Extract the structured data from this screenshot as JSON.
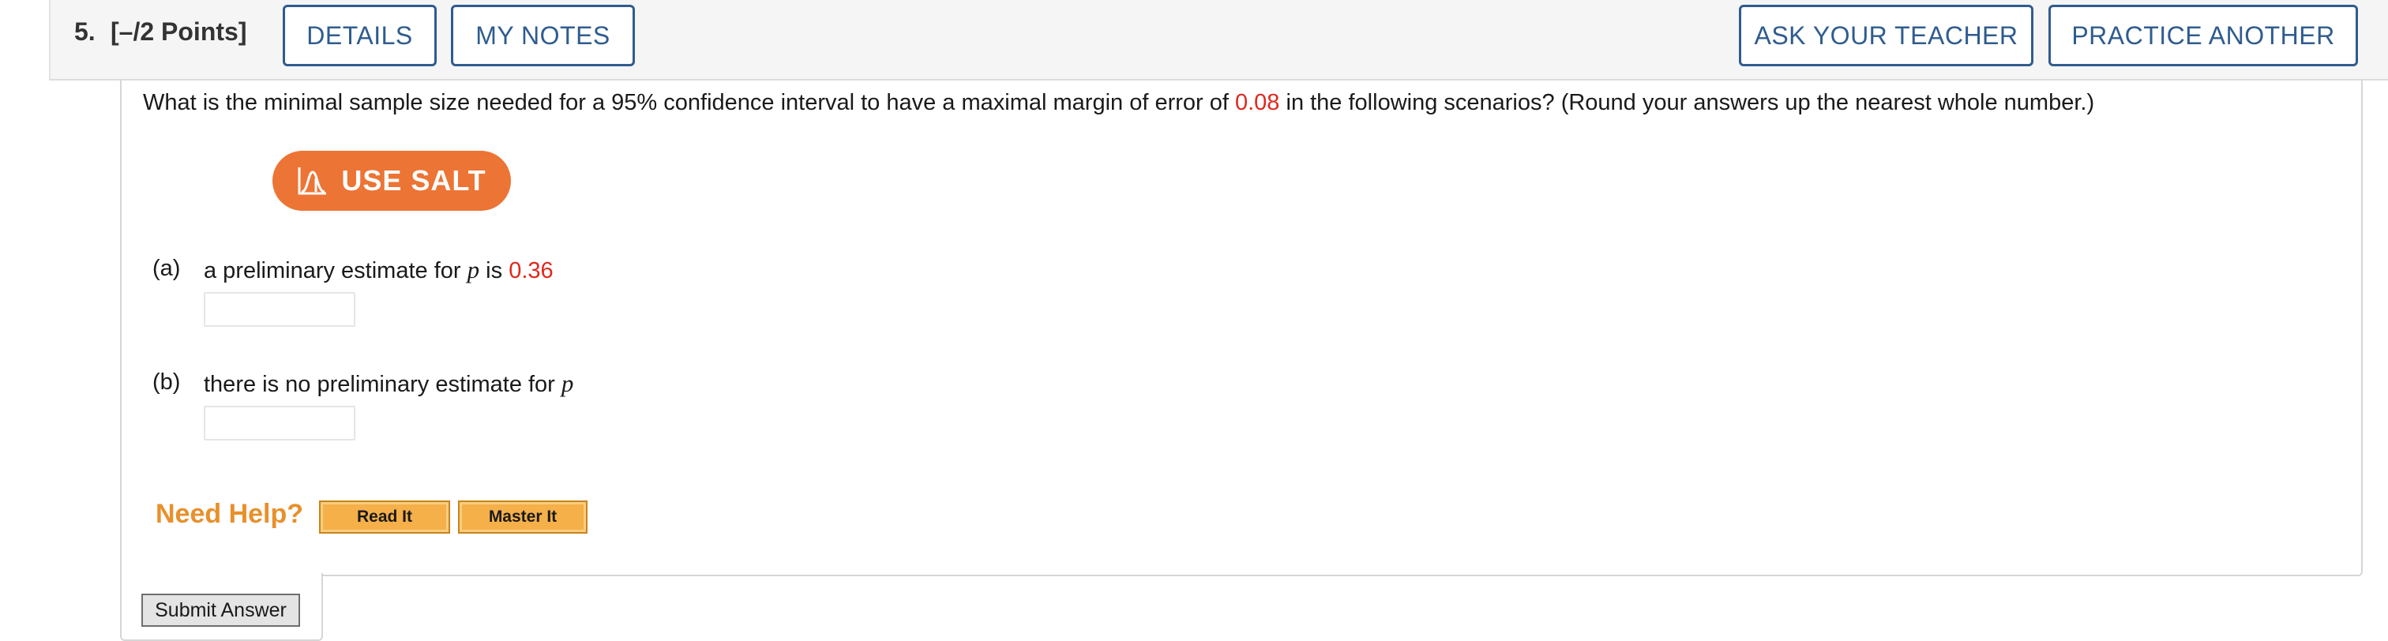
{
  "header": {
    "question_number": "5.",
    "points": "[–/2 Points]",
    "details_label": "DETAILS",
    "my_notes_label": "MY NOTES",
    "ask_teacher_label": "ASK YOUR TEACHER",
    "practice_another_label": "PRACTICE ANOTHER"
  },
  "question": {
    "text_before": "What is the minimal sample size needed for a 95% confidence interval to have a maximal margin of error of ",
    "margin_value": "0.08",
    "text_after": " in the following scenarios? (Round your answers up the nearest whole number.)"
  },
  "salt": {
    "label": "USE SALT"
  },
  "parts": [
    {
      "label": "(a)",
      "text_before": "a preliminary estimate for ",
      "variable": "p",
      "text_middle": " is ",
      "value": "0.36",
      "answer_value": ""
    },
    {
      "label": "(b)",
      "text_before": "there is no preliminary estimate for ",
      "variable": "p",
      "answer_value": ""
    }
  ],
  "help": {
    "title": "Need Help?",
    "read_it_label": "Read It",
    "master_it_label": "Master It"
  },
  "submit": {
    "label": "Submit Answer"
  },
  "colors": {
    "accent_blue": "#2f5c8f",
    "salt_orange": "#ec7434",
    "randomized_red": "#e0281e",
    "help_orange": "#e8902c"
  }
}
